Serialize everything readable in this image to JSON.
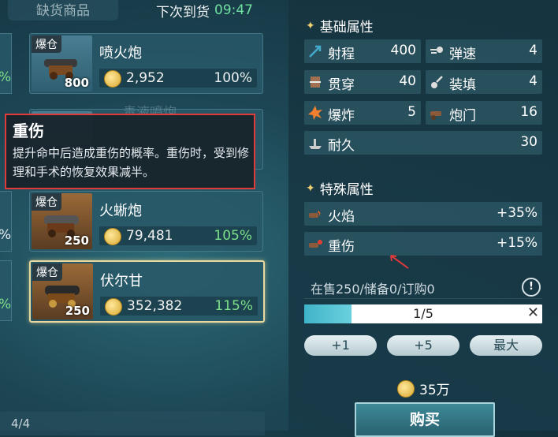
{
  "header": {
    "missing_tab": "缺货商品",
    "restock_label": "下次到货",
    "restock_time": "09:47"
  },
  "items": [
    {
      "tag": "爆仓",
      "name": "喷火炮",
      "qty": "800",
      "price": "2,952",
      "pct": "100%",
      "pct_green": false,
      "edge_pct": "%"
    },
    {
      "tag": "爆仓",
      "name": "毒液噴炮",
      "qty": "",
      "price": "",
      "pct": "",
      "pct_green": false,
      "edge_pct": "%"
    },
    {
      "tag": "爆仓",
      "name": "火蜥炮",
      "qty": "250",
      "price": "79,481",
      "pct": "105%",
      "pct_green": true,
      "edge_pct": "%"
    },
    {
      "tag": "爆仓",
      "name": "伏尔甘",
      "qty": "250",
      "price": "352,382",
      "pct": "115%",
      "pct_green": true,
      "edge_pct": "%"
    }
  ],
  "tooltip": {
    "title": "重伤",
    "desc": "提升命中后造成重伤的概率。重伤时，受到修理和手术的恢复效果减半。"
  },
  "footer": {
    "page": "4/4"
  },
  "basic": {
    "title": "基础属性",
    "stats": [
      {
        "icon": "range-icon",
        "label": "射程",
        "value": "400"
      },
      {
        "icon": "bullet-speed-icon",
        "label": "弹速",
        "value": "4"
      },
      {
        "icon": "penetration-icon",
        "label": "贯穿",
        "value": "40"
      },
      {
        "icon": "reload-icon",
        "label": "装填",
        "value": "4"
      },
      {
        "icon": "explosion-icon",
        "label": "爆炸",
        "value": "5"
      },
      {
        "icon": "gun-port-icon",
        "label": "炮门",
        "value": "16"
      },
      {
        "icon": "durability-icon",
        "label": "耐久",
        "value": "30"
      }
    ]
  },
  "special": {
    "title": "特殊属性",
    "stats": [
      {
        "icon": "fire-cannon-icon",
        "label": "火焰",
        "value": "+35%"
      },
      {
        "icon": "heavy-wound-cannon-icon",
        "label": "重伤",
        "value": "+15%"
      }
    ]
  },
  "stock": {
    "text": "在售250/储备0/订购0",
    "bang": "!"
  },
  "purchase": {
    "progress_text": "1/5",
    "progress_fraction": 0.2,
    "close": "✕",
    "buttons": [
      "+1",
      "+5",
      "最大"
    ],
    "cost": "35万",
    "buy_label": "购买"
  },
  "colors": {
    "accent_green": "#6fe0a0",
    "highlight_red": "#e03a3a",
    "gold": "#d8a830"
  }
}
